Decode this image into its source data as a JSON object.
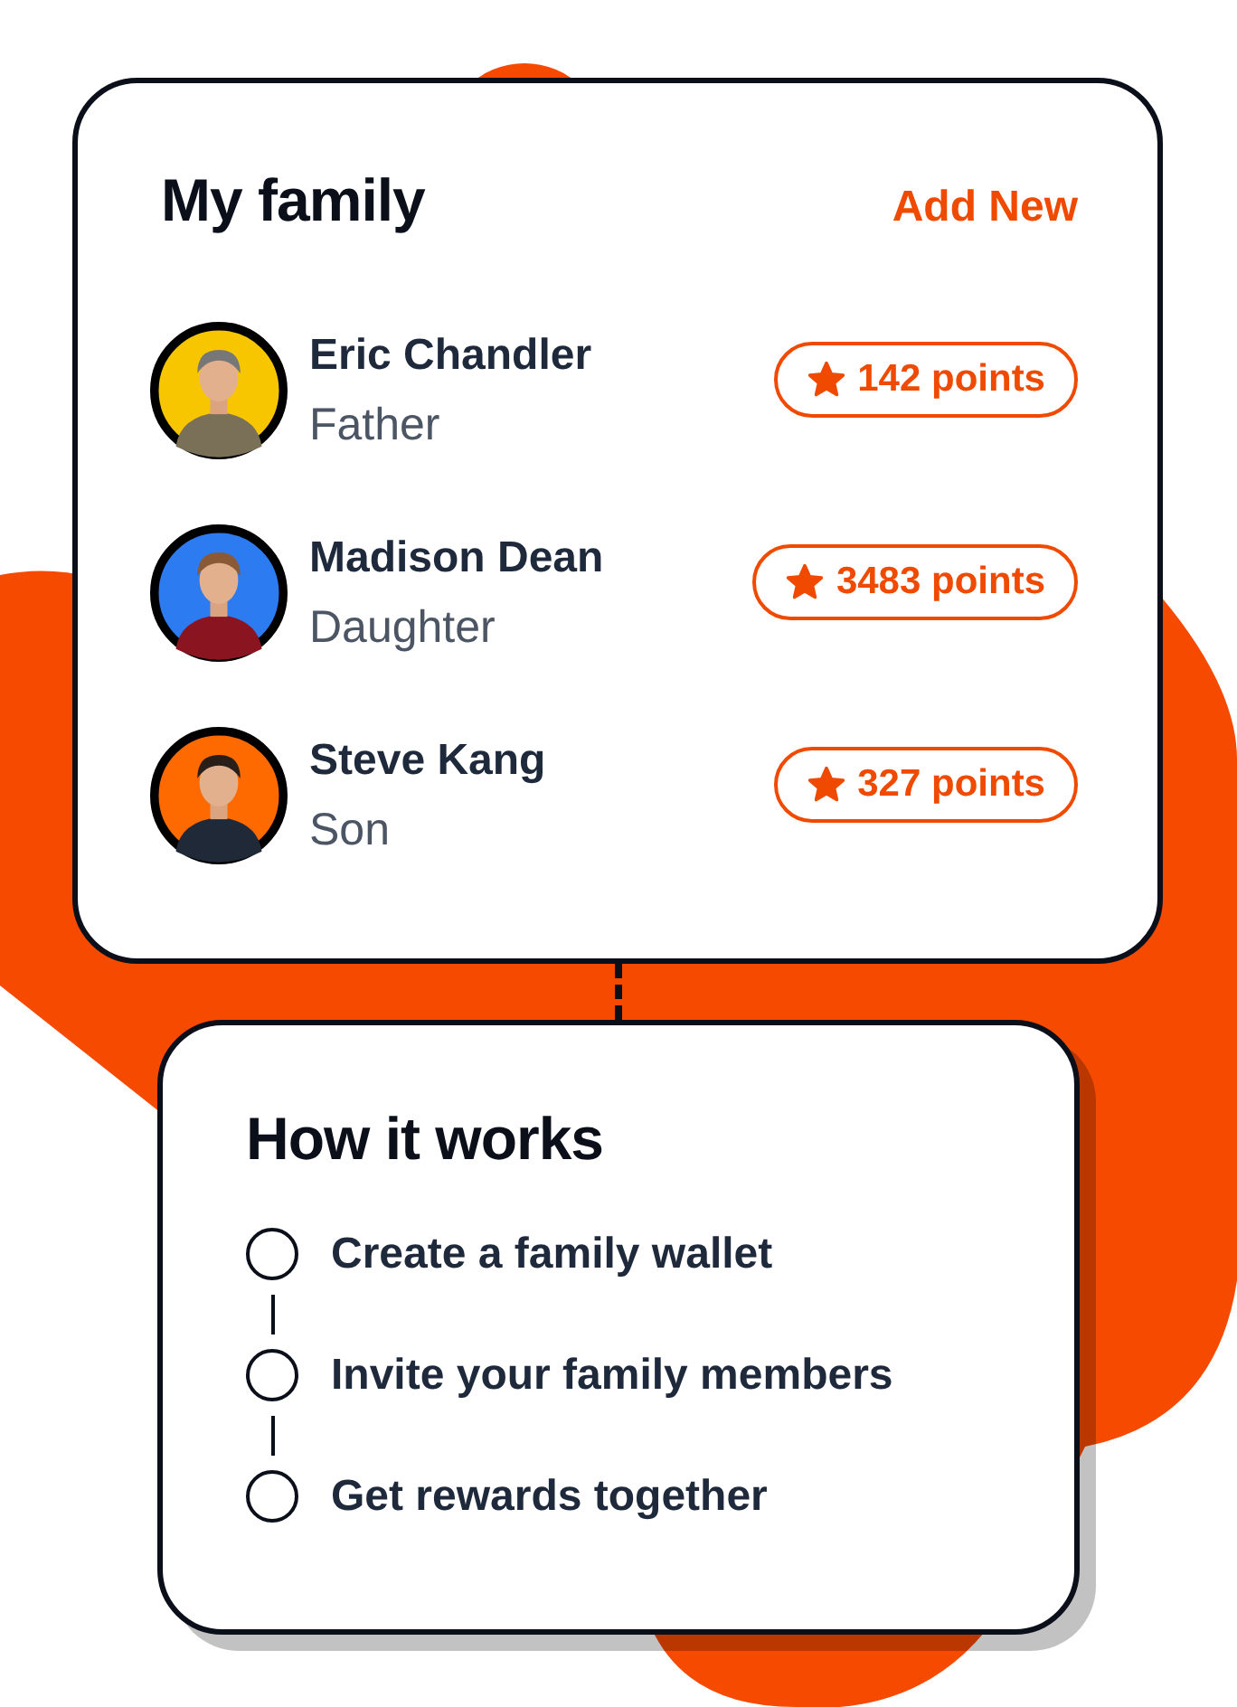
{
  "family_card": {
    "title": "My family",
    "action": "Add New",
    "members": [
      {
        "name": "Eric Chandler",
        "role": "Father",
        "points": "142 points"
      },
      {
        "name": "Madison Dean",
        "role": "Daughter",
        "points": "3483 points"
      },
      {
        "name": "Steve Kang",
        "role": "Son",
        "points": "327 points"
      }
    ]
  },
  "how_it_works": {
    "title": "How it works",
    "steps": [
      {
        "label": "Create a family wallet"
      },
      {
        "label": "Invite your family members"
      },
      {
        "label": "Get rewards together"
      }
    ]
  }
}
